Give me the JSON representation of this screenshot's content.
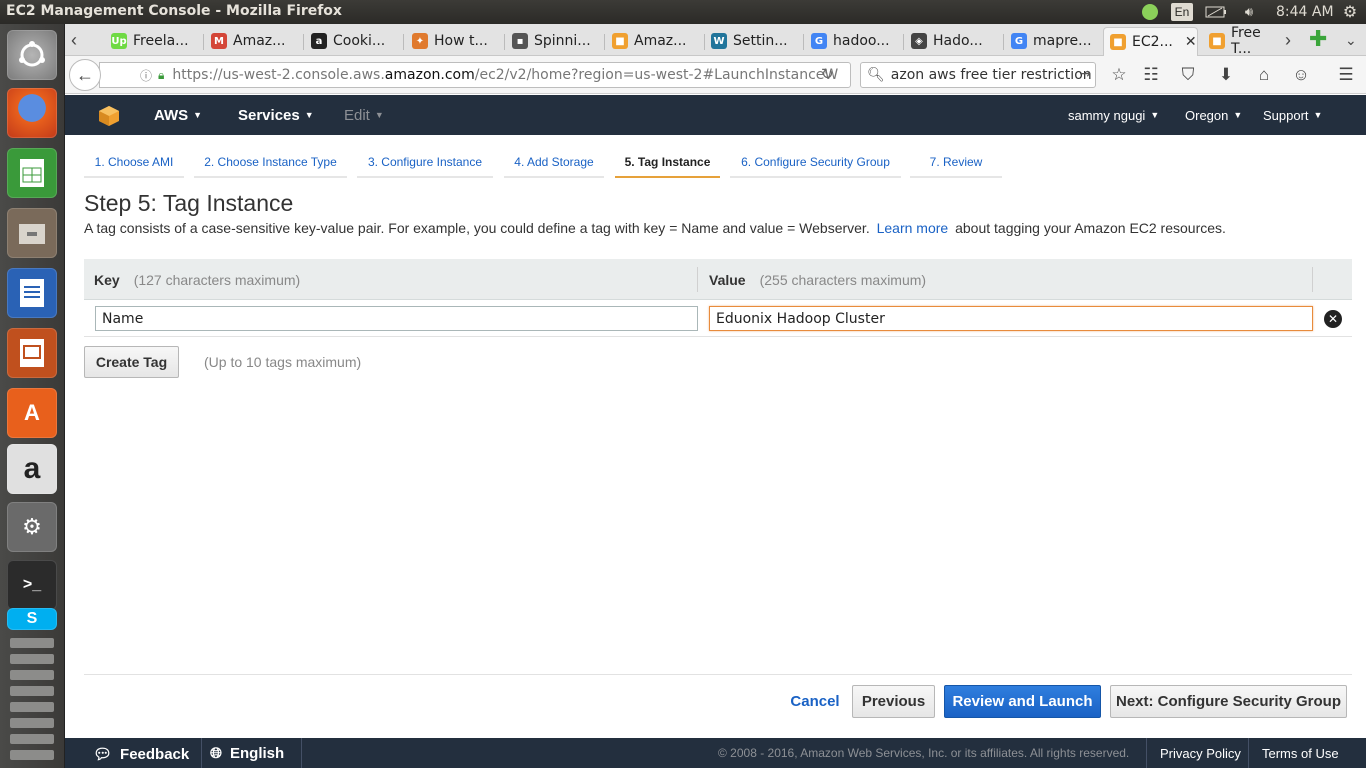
{
  "window": {
    "title": "EC2 Management Console - Mozilla Firefox",
    "clock": "8:44 AM",
    "keyboard": "En"
  },
  "tabs": [
    {
      "label": "Freela...",
      "fav_color": "#6fda44",
      "fav_glyph": "Up"
    },
    {
      "label": "Amaz...",
      "fav_color": "#d44638",
      "fav_glyph": "M"
    },
    {
      "label": "Cooki...",
      "fav_color": "#222222",
      "fav_glyph": "a"
    },
    {
      "label": "How t...",
      "fav_color": "#e07a2e",
      "fav_glyph": "✦"
    },
    {
      "label": "Spinni...",
      "fav_color": "#555555",
      "fav_glyph": "▪"
    },
    {
      "label": "Amaz...",
      "fav_color": "#f0a030",
      "fav_glyph": "■"
    },
    {
      "label": "Settin...",
      "fav_color": "#21759b",
      "fav_glyph": "W"
    },
    {
      "label": "hadoo...",
      "fav_color": "#4285f4",
      "fav_glyph": "G"
    },
    {
      "label": "Hado...",
      "fav_color": "#444444",
      "fav_glyph": "◈"
    },
    {
      "label": "mapre...",
      "fav_color": "#4285f4",
      "fav_glyph": "G"
    },
    {
      "label": "EC2...",
      "fav_color": "#f0a030",
      "fav_glyph": "■",
      "active": true
    },
    {
      "label": "Free T...",
      "fav_color": "#f0a030",
      "fav_glyph": "■"
    }
  ],
  "navbar": {
    "url_prefix": "https://us-west-2.console.aws.",
    "url_domain": "amazon.com",
    "url_suffix": "/ec2/v2/home?region=us-west-2#LaunchInstanceW",
    "search_value": "azon aws free tier restriction"
  },
  "aws_header": {
    "aws_label": "AWS",
    "services_label": "Services",
    "edit_label": "Edit",
    "user": "sammy ngugi",
    "region": "Oregon",
    "support": "Support"
  },
  "wizard_steps": [
    "1. Choose AMI",
    "2. Choose Instance Type",
    "3. Configure Instance",
    "4. Add Storage",
    "5. Tag Instance",
    "6. Configure Security Group",
    "7. Review"
  ],
  "page": {
    "title": "Step 5: Tag Instance",
    "intro_before": "A tag consists of a case-sensitive key-value pair. For example, you could define a tag with key = Name and value = Webserver.",
    "intro_link": "Learn more",
    "intro_after": "about tagging your Amazon EC2 resources."
  },
  "tag_table": {
    "key_header": "Key",
    "key_hint": "(127 characters maximum)",
    "value_header": "Value",
    "value_hint": "(255 characters maximum)",
    "rows": [
      {
        "key": "Name",
        "value": "Eduonix Hadoop Cluster"
      }
    ]
  },
  "create_tag": {
    "label": "Create Tag",
    "note": "(Up to 10 tags maximum)"
  },
  "buttons": {
    "cancel": "Cancel",
    "previous": "Previous",
    "review_launch": "Review and Launch",
    "next": "Next: Configure Security Group"
  },
  "footer": {
    "feedback": "Feedback",
    "language": "English",
    "copyright": "© 2008 - 2016, Amazon Web Services, Inc. or its affiliates. All rights reserved.",
    "privacy": "Privacy Policy",
    "terms": "Terms of Use"
  },
  "colors": {
    "aws_dark": "#232f3e",
    "link_blue": "#1a62c5",
    "active_step": "#e6a13a",
    "primary": "#1a62c5"
  }
}
